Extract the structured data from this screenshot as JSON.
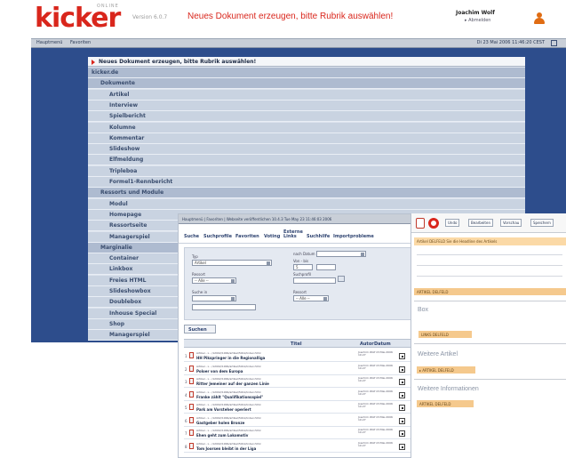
{
  "cms": {
    "logo": "kicker",
    "logo_sub": "ONLINE",
    "version": "Version 6.0.7",
    "title": "Neues Dokument erzeugen, bitte Rubrik auswählen!",
    "user_name": "Joachim Wolf",
    "logout": "▸ Abmelden",
    "toolbar": {
      "home": "Hauptmenü",
      "favorites": "Favoriten",
      "date": "Di 23 Mai 2006 11:46:20 CEST"
    },
    "tree_header": "Neues Dokument erzeugen, bitte Rubrik auswählen!",
    "tree": [
      {
        "label": "kicker.de",
        "level": 0
      },
      {
        "label": "Dokumente",
        "level": 1
      },
      {
        "label": "Artikel",
        "level": 2
      },
      {
        "label": "Interview",
        "level": 2
      },
      {
        "label": "Spielbericht",
        "level": 2
      },
      {
        "label": "Kolumne",
        "level": 2
      },
      {
        "label": "Kommentar",
        "level": 2
      },
      {
        "label": "Slideshow",
        "level": 2
      },
      {
        "label": "Elfmeldung",
        "level": 2
      },
      {
        "label": "Tripleboa",
        "level": 2
      },
      {
        "label": "Formel1-Rennbericht",
        "level": 2
      },
      {
        "label": "Ressorts und Module",
        "level": 1
      },
      {
        "label": "Modul",
        "level": 2
      },
      {
        "label": "Homepage",
        "level": 2
      },
      {
        "label": "Ressortseite",
        "level": 2
      },
      {
        "label": "Managerspiel",
        "level": 2
      },
      {
        "label": "Marginalie",
        "level": 1
      },
      {
        "label": "Container",
        "level": 2
      },
      {
        "label": "Linkbox",
        "level": 2
      },
      {
        "label": "Freies HTML",
        "level": 2
      },
      {
        "label": "Slideshowbox",
        "level": 2
      },
      {
        "label": "Doublebox",
        "level": 2
      },
      {
        "label": "Inhouse Special",
        "level": 2
      },
      {
        "label": "Shop",
        "level": 2
      },
      {
        "label": "Managerspiel",
        "level": 2
      }
    ]
  },
  "search": {
    "topbar": "Hauptmenü | Favoriten | Webseite veröffentlichen 10.4.3 Tue May 23 11:46:03 2006",
    "tabs": [
      "Suche",
      "Suchprofile",
      "Favoriten",
      "Voting",
      "Externe Links",
      "Suchhilfe",
      "Importprobleme"
    ],
    "labels": {
      "typ": "Typ",
      "nach_datum": "nach Datum",
      "date_range": "Von - bis",
      "ressort1": "Ressort",
      "suchprofil": "Suchprofil",
      "suche_in": "Suche in",
      "ressort2": "Ressort"
    },
    "values": {
      "typ": "Artikel",
      "nach_datum": "",
      "von": "5",
      "ressort1": "-- Alle --",
      "ressort2": "-- Alle --"
    },
    "search_button": "Suchen",
    "col_title": "Titel",
    "col_date": "Datum",
    "col_author": "Autor",
    "results": [
      {
        "path": "Artikel - L - /12002/1999/artikel/5912/index.html",
        "title": "HH Pikspringer in die Regionalliga",
        "date": "Joachim Wolf 23.Mai.2006 10:27"
      },
      {
        "path": "Artikel - L - /12002/1999/artikel/5912/index.html",
        "title": "Poloer von dem Europa",
        "date": "Joachim Wolf 23.Mai.2006 10:27"
      },
      {
        "path": "Artikel - L - /12002/1999/artikel/5912/index.html",
        "title": "Ritter Jemeiner auf der ganzen Linie",
        "date": "Joachim Wolf 23.Mai.2006 10:27"
      },
      {
        "path": "Artikel - L - /12002/1999/artikel/5912/index.html",
        "title": "Franke zählt \"Qualifikationsspiel\"",
        "date": "Joachim Wolf 23.Mai.2006 10:27"
      },
      {
        "path": "Artikel - L - /12002/1999/artikel/5912/index.html",
        "title": "Park am Vorsteher operiert",
        "date": "Joachim Wolf 23.Mai.2006 10:27"
      },
      {
        "path": "Artikel - L - /12002/1999/artikel/5912/index.html",
        "title": "Gastgeber holen Bronze",
        "date": "Joachim Wolf 23.Mai.2006 10:27"
      },
      {
        "path": "Artikel - L - /12002/1999/artikel/5912/index.html",
        "title": "Ehen geht zum Lokomotiv",
        "date": "Joachim Wolf 23.Mai.2006 10:27"
      },
      {
        "path": "Artikel - L - /12002/1999/artikel/5912/index.html",
        "title": "Tom Joorsen bleibt in der Liga",
        "date": "Joachim Wolf 23.Mai.2006 10:27"
      }
    ]
  },
  "editor": {
    "buttons": [
      "Undo",
      "Bearbeiten",
      "Vorschau",
      "Speichern"
    ],
    "headline": "Artikel DELFELD Sie die Headline des Artikels",
    "tag1": "ARTIKEL DELFELD",
    "sec_box": "Box",
    "tag2": "LINKS DELFELD",
    "sec_weitere_artikel": "Weitere Artikel",
    "tag3": "▸ ARTIKEL DELFELD",
    "sec_weitere_info": "Weitere Informationen",
    "tag4": "ARTIKEL DELFELD"
  }
}
